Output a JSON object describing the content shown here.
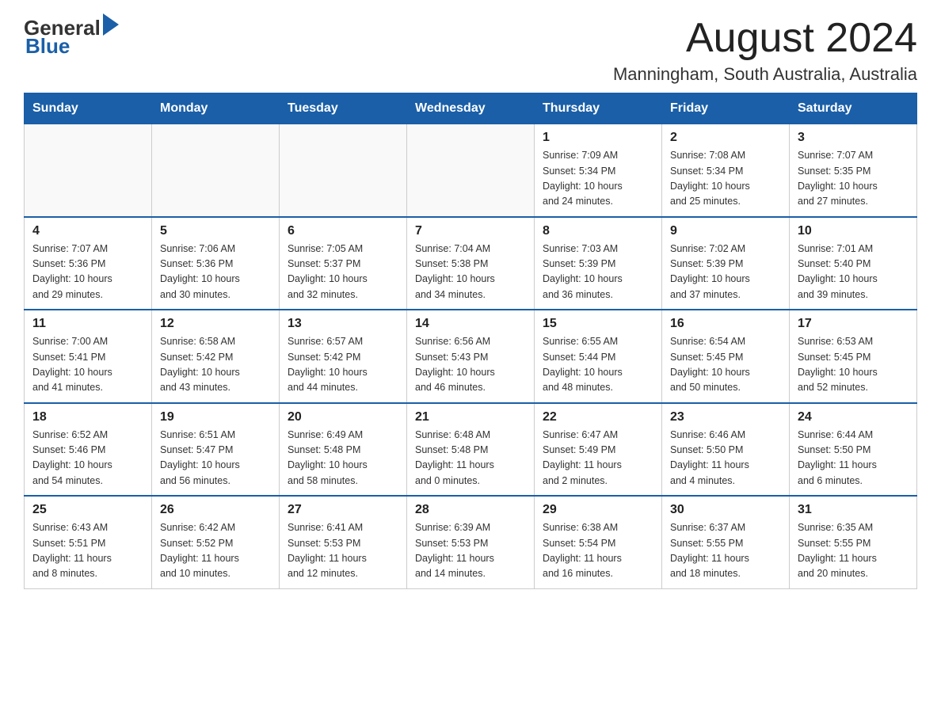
{
  "header": {
    "logo_general": "General",
    "logo_blue": "Blue",
    "month_title": "August 2024",
    "location": "Manningham, South Australia, Australia"
  },
  "days_of_week": [
    "Sunday",
    "Monday",
    "Tuesday",
    "Wednesday",
    "Thursday",
    "Friday",
    "Saturday"
  ],
  "weeks": [
    [
      {
        "day": "",
        "info": ""
      },
      {
        "day": "",
        "info": ""
      },
      {
        "day": "",
        "info": ""
      },
      {
        "day": "",
        "info": ""
      },
      {
        "day": "1",
        "info": "Sunrise: 7:09 AM\nSunset: 5:34 PM\nDaylight: 10 hours\nand 24 minutes."
      },
      {
        "day": "2",
        "info": "Sunrise: 7:08 AM\nSunset: 5:34 PM\nDaylight: 10 hours\nand 25 minutes."
      },
      {
        "day": "3",
        "info": "Sunrise: 7:07 AM\nSunset: 5:35 PM\nDaylight: 10 hours\nand 27 minutes."
      }
    ],
    [
      {
        "day": "4",
        "info": "Sunrise: 7:07 AM\nSunset: 5:36 PM\nDaylight: 10 hours\nand 29 minutes."
      },
      {
        "day": "5",
        "info": "Sunrise: 7:06 AM\nSunset: 5:36 PM\nDaylight: 10 hours\nand 30 minutes."
      },
      {
        "day": "6",
        "info": "Sunrise: 7:05 AM\nSunset: 5:37 PM\nDaylight: 10 hours\nand 32 minutes."
      },
      {
        "day": "7",
        "info": "Sunrise: 7:04 AM\nSunset: 5:38 PM\nDaylight: 10 hours\nand 34 minutes."
      },
      {
        "day": "8",
        "info": "Sunrise: 7:03 AM\nSunset: 5:39 PM\nDaylight: 10 hours\nand 36 minutes."
      },
      {
        "day": "9",
        "info": "Sunrise: 7:02 AM\nSunset: 5:39 PM\nDaylight: 10 hours\nand 37 minutes."
      },
      {
        "day": "10",
        "info": "Sunrise: 7:01 AM\nSunset: 5:40 PM\nDaylight: 10 hours\nand 39 minutes."
      }
    ],
    [
      {
        "day": "11",
        "info": "Sunrise: 7:00 AM\nSunset: 5:41 PM\nDaylight: 10 hours\nand 41 minutes."
      },
      {
        "day": "12",
        "info": "Sunrise: 6:58 AM\nSunset: 5:42 PM\nDaylight: 10 hours\nand 43 minutes."
      },
      {
        "day": "13",
        "info": "Sunrise: 6:57 AM\nSunset: 5:42 PM\nDaylight: 10 hours\nand 44 minutes."
      },
      {
        "day": "14",
        "info": "Sunrise: 6:56 AM\nSunset: 5:43 PM\nDaylight: 10 hours\nand 46 minutes."
      },
      {
        "day": "15",
        "info": "Sunrise: 6:55 AM\nSunset: 5:44 PM\nDaylight: 10 hours\nand 48 minutes."
      },
      {
        "day": "16",
        "info": "Sunrise: 6:54 AM\nSunset: 5:45 PM\nDaylight: 10 hours\nand 50 minutes."
      },
      {
        "day": "17",
        "info": "Sunrise: 6:53 AM\nSunset: 5:45 PM\nDaylight: 10 hours\nand 52 minutes."
      }
    ],
    [
      {
        "day": "18",
        "info": "Sunrise: 6:52 AM\nSunset: 5:46 PM\nDaylight: 10 hours\nand 54 minutes."
      },
      {
        "day": "19",
        "info": "Sunrise: 6:51 AM\nSunset: 5:47 PM\nDaylight: 10 hours\nand 56 minutes."
      },
      {
        "day": "20",
        "info": "Sunrise: 6:49 AM\nSunset: 5:48 PM\nDaylight: 10 hours\nand 58 minutes."
      },
      {
        "day": "21",
        "info": "Sunrise: 6:48 AM\nSunset: 5:48 PM\nDaylight: 11 hours\nand 0 minutes."
      },
      {
        "day": "22",
        "info": "Sunrise: 6:47 AM\nSunset: 5:49 PM\nDaylight: 11 hours\nand 2 minutes."
      },
      {
        "day": "23",
        "info": "Sunrise: 6:46 AM\nSunset: 5:50 PM\nDaylight: 11 hours\nand 4 minutes."
      },
      {
        "day": "24",
        "info": "Sunrise: 6:44 AM\nSunset: 5:50 PM\nDaylight: 11 hours\nand 6 minutes."
      }
    ],
    [
      {
        "day": "25",
        "info": "Sunrise: 6:43 AM\nSunset: 5:51 PM\nDaylight: 11 hours\nand 8 minutes."
      },
      {
        "day": "26",
        "info": "Sunrise: 6:42 AM\nSunset: 5:52 PM\nDaylight: 11 hours\nand 10 minutes."
      },
      {
        "day": "27",
        "info": "Sunrise: 6:41 AM\nSunset: 5:53 PM\nDaylight: 11 hours\nand 12 minutes."
      },
      {
        "day": "28",
        "info": "Sunrise: 6:39 AM\nSunset: 5:53 PM\nDaylight: 11 hours\nand 14 minutes."
      },
      {
        "day": "29",
        "info": "Sunrise: 6:38 AM\nSunset: 5:54 PM\nDaylight: 11 hours\nand 16 minutes."
      },
      {
        "day": "30",
        "info": "Sunrise: 6:37 AM\nSunset: 5:55 PM\nDaylight: 11 hours\nand 18 minutes."
      },
      {
        "day": "31",
        "info": "Sunrise: 6:35 AM\nSunset: 5:55 PM\nDaylight: 11 hours\nand 20 minutes."
      }
    ]
  ]
}
